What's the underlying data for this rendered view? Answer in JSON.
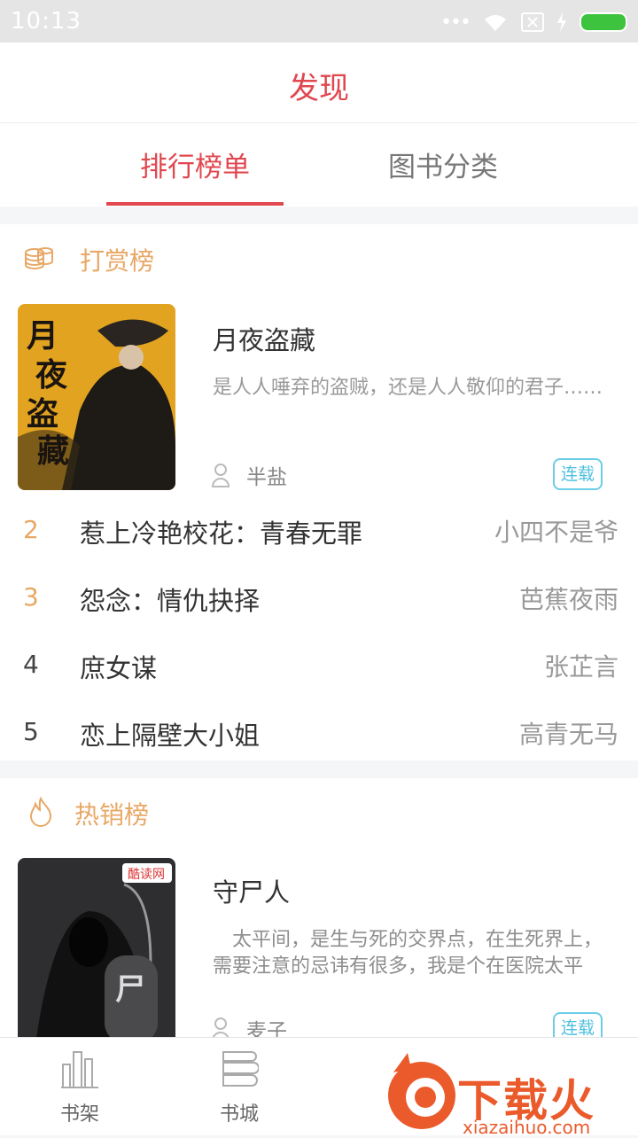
{
  "status_bar": {
    "time": "10:13",
    "accent": "#3ec33e"
  },
  "header": {
    "title": "发现",
    "color": "#e0474f"
  },
  "tabs": [
    {
      "label": "排行榜单",
      "active": true
    },
    {
      "label": "图书分类",
      "active": false
    }
  ],
  "sections": [
    {
      "title": "打赏榜",
      "icon": "coins-icon",
      "featured": {
        "title": "月夜盗藏",
        "description": "是人人唾弃的盗贼，还是人人敬仰的君子……",
        "author": "半盐",
        "badge": "连载",
        "cover_text": "月夜盗藏"
      },
      "ranks": [
        {
          "rank": "2",
          "title": "惹上冷艳校花：青春无罪",
          "author": "小四不是爷"
        },
        {
          "rank": "3",
          "title": "怨念：情仇抉择",
          "author": "芭蕉夜雨"
        },
        {
          "rank": "4",
          "title": "庶女谋",
          "author": "张芷言"
        },
        {
          "rank": "5",
          "title": "恋上隔壁大小姐",
          "author": "高青无马"
        }
      ]
    },
    {
      "title": "热销榜",
      "icon": "flame-icon",
      "featured": {
        "title": "守尸人",
        "description": "　太平间，是生与死的交界点，在生死界上，需要注意的忌讳有很多，我是个在医院太平",
        "author": "麦子",
        "badge": "连载",
        "cover_text": "守尸人",
        "cover_logo": "酷读网"
      }
    }
  ],
  "bottom_nav": [
    {
      "label": "书架",
      "icon": "bookshelf-icon"
    },
    {
      "label": "书城",
      "icon": "bookstore-icon"
    }
  ],
  "watermark": {
    "text": "下载火",
    "url": "xiazaihuo.com"
  }
}
